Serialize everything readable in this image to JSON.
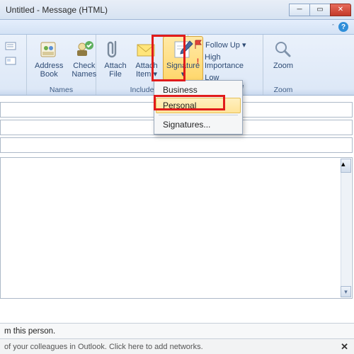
{
  "window": {
    "title": "Untitled - Message (HTML)"
  },
  "ribbon": {
    "groups": {
      "names": {
        "label": "Names",
        "address_book": "Address\nBook",
        "check_names": "Check\nNames"
      },
      "include": {
        "label": "Include",
        "attach_file": "Attach\nFile",
        "attach_item": "Attach\nItem ▾",
        "signature": "Signature\n▾"
      },
      "tags": {
        "follow_up": "Follow Up ▾",
        "high": "High Importance",
        "low": "Low Importance"
      },
      "zoom": {
        "label": "Zoom",
        "zoom": "Zoom"
      }
    }
  },
  "signature_menu": {
    "items": [
      "Business",
      "Personal",
      "Signatures..."
    ],
    "selected_index": 1
  },
  "footer": {
    "line1": "m this person.",
    "line2": "of your colleagues in Outlook. Click here to add networks."
  }
}
